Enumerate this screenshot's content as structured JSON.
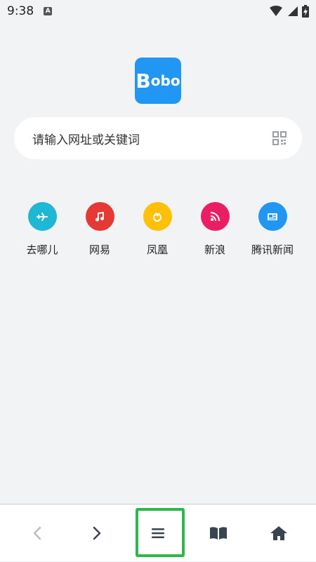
{
  "status_bar": {
    "time": "9:38",
    "notification_letter": "A"
  },
  "logo": {
    "text_big": "B",
    "text_small": "obo"
  },
  "search": {
    "placeholder": "请输入网址或关键词",
    "qr_icon": "qr-scan-icon"
  },
  "shortcuts": [
    {
      "label": "去哪儿",
      "icon": "airplane-icon",
      "color": "#1fb8d4"
    },
    {
      "label": "网易",
      "icon": "music-note-icon",
      "color": "#e53935"
    },
    {
      "label": "凤凰",
      "icon": "phoenix-icon",
      "color": "#ffc107"
    },
    {
      "label": "新浪",
      "icon": "rss-icon",
      "color": "#e91e63"
    },
    {
      "label": "腾讯新闻",
      "icon": "news-icon",
      "color": "#2196f3"
    }
  ],
  "bottom_nav": {
    "back_icon": "chevron-left-icon",
    "forward_icon": "chevron-right-icon",
    "menu_icon": "menu-icon",
    "bookmarks_icon": "book-icon",
    "home_icon": "home-icon",
    "highlight_color": "#2fb84a"
  }
}
